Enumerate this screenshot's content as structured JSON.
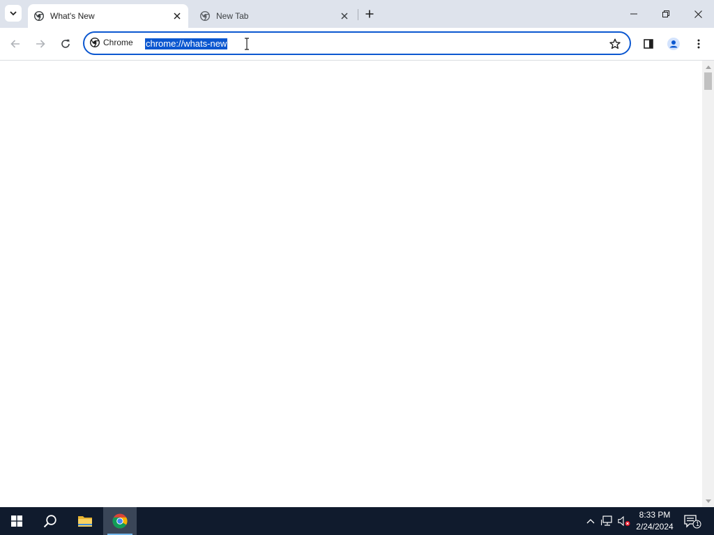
{
  "tabs": [
    {
      "title": "What's New",
      "active": true
    },
    {
      "title": "New Tab",
      "active": false
    }
  ],
  "omnibox": {
    "chip_label": "Chrome",
    "url": "chrome://whats-new",
    "url_selected": true
  },
  "taskbar": {
    "time": "8:33 PM",
    "date": "2/24/2024",
    "notification_count": "1"
  },
  "colors": {
    "titlebar": "#dee3ec",
    "accent": "#0b57d0",
    "taskbar": "#101b2d"
  }
}
